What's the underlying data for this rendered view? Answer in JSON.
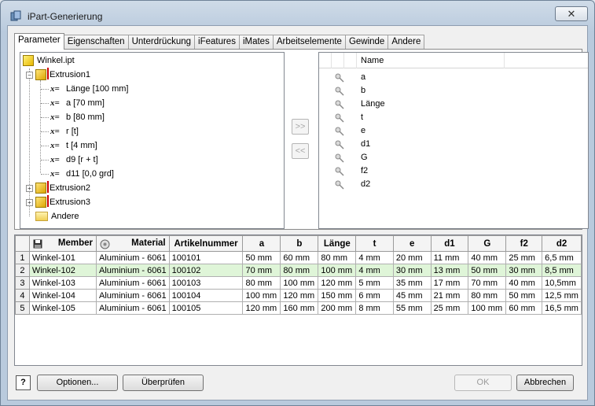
{
  "window": {
    "title": "iPart-Generierung",
    "close_glyph": "✕"
  },
  "tabs": [
    "Parameter",
    "Eigenschaften",
    "Unterdrückung",
    "iFeatures",
    "iMates",
    "Arbeitselemente",
    "Gewinde",
    "Andere"
  ],
  "tree": {
    "root": "Winkel.ipt",
    "extrusion1": "Extrusion1",
    "params": [
      "Länge [100 mm]",
      "a [70 mm]",
      "b [80 mm]",
      "r [t]",
      "t [4 mm]",
      "d9 [r + t]",
      "d11 [0,0 grd]"
    ],
    "param_prefix": "x=",
    "extrusion2": "Extrusion2",
    "extrusion3": "Extrusion3",
    "other": "Andere",
    "expand_glyph": "+",
    "collapse_glyph": "−"
  },
  "move_buttons": {
    "add": ">>",
    "remove": "<<"
  },
  "param_list": {
    "header": "Name",
    "items": [
      "a",
      "b",
      "Länge",
      "t",
      "e",
      "d1",
      "G",
      "f2",
      "d2"
    ],
    "icon": "key-icon"
  },
  "table": {
    "columns": [
      "Member",
      "Material",
      "Artikelnummer",
      "a",
      "b",
      "Länge",
      "t",
      "e",
      "d1",
      "G",
      "f2",
      "d2"
    ],
    "rows": [
      {
        "num": "1",
        "cells": [
          "Winkel-101",
          "Aluminium - 6061",
          "100101",
          "50 mm",
          "60 mm",
          "80 mm",
          "4 mm",
          "20 mm",
          "11 mm",
          "40 mm",
          "25 mm",
          "6,5 mm"
        ]
      },
      {
        "num": "2",
        "cells": [
          "Winkel-102",
          "Aluminium - 6061",
          "100102",
          "70 mm",
          "80 mm",
          "100 mm",
          "4 mm",
          "30 mm",
          "13 mm",
          "50 mm",
          "30 mm",
          "8,5 mm"
        ]
      },
      {
        "num": "3",
        "cells": [
          "Winkel-103",
          "Aluminium - 6061",
          "100103",
          "80 mm",
          "100 mm",
          "120 mm",
          "5 mm",
          "35 mm",
          "17 mm",
          "70 mm",
          "40 mm",
          "10,5mm"
        ]
      },
      {
        "num": "4",
        "cells": [
          "Winkel-104",
          "Aluminium - 6061",
          "100104",
          "100 mm",
          "120 mm",
          "150 mm",
          "6 mm",
          "45 mm",
          "21 mm",
          "80 mm",
          "50 mm",
          "12,5 mm"
        ]
      },
      {
        "num": "5",
        "cells": [
          "Winkel-105",
          "Aluminium - 6061",
          "100105",
          "120 mm",
          "160 mm",
          "200 mm",
          "8 mm",
          "55 mm",
          "25 mm",
          "100 mm",
          "60 mm",
          "16,5 mm"
        ]
      }
    ],
    "selected_row": 2
  },
  "buttons": {
    "help": "?",
    "options": "Optionen...",
    "check": "Überprüfen",
    "ok": "OK",
    "cancel": "Abbrechen"
  },
  "colors": {
    "selected_row": "#dff5d8",
    "accent": "#c00000"
  }
}
